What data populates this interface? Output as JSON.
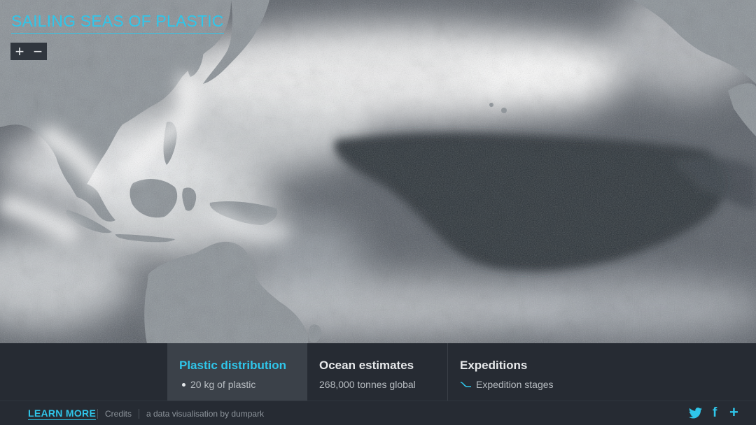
{
  "app": {
    "title": "SAILING SEAS OF PLASTIC"
  },
  "map_controls": {
    "zoom_in": "+",
    "zoom_out": "−"
  },
  "panel": {
    "tabs": [
      {
        "label": "Plastic distribution",
        "sub": "20 kg of plastic",
        "active": true,
        "legend_icon": "white-dot-icon"
      },
      {
        "label": "Ocean estimates",
        "sub": "268,000 tonnes global",
        "active": false
      },
      {
        "label": "Expeditions",
        "sub": "Expedition stages",
        "active": false,
        "legend_icon": "expedition-line-icon"
      }
    ]
  },
  "footer": {
    "learn_more": "LEARN MORE",
    "credits": "Credits",
    "byline": "a data visualisation by dumpark",
    "social": [
      {
        "name": "twitter-icon",
        "glyph": "🐦"
      },
      {
        "name": "facebook-icon",
        "glyph": "f"
      },
      {
        "name": "share-plus-icon",
        "glyph": "+"
      }
    ]
  },
  "colors": {
    "accent": "#2fc6ea",
    "panel_bg": "#262b33",
    "active_tab_bg": "#3b4149",
    "land": "#8c9399",
    "ocean_dark": "#2b3038",
    "plastic_density": "#ffffff"
  }
}
